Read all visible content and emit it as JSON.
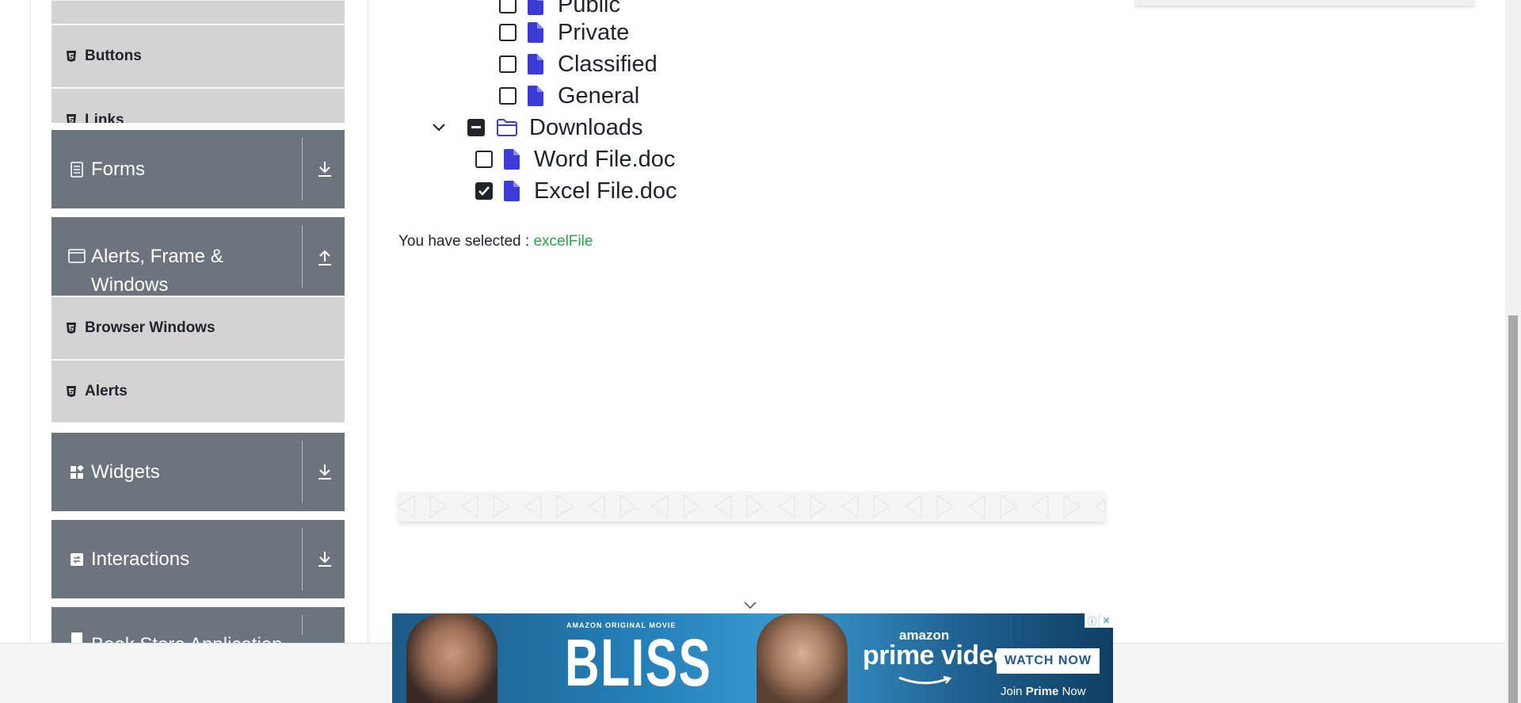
{
  "sidebar": {
    "elements_sub": [
      {
        "label": "Buttons"
      },
      {
        "label": "Links"
      }
    ],
    "groups": {
      "forms": "Forms",
      "alerts": "Alerts, Frame & Windows",
      "widgets": "Widgets",
      "interactions": "Interactions",
      "bookstore": "Book Store Application"
    },
    "alerts_sub": [
      {
        "label": "Browser Windows"
      },
      {
        "label": "Alerts"
      }
    ]
  },
  "tree": {
    "items": [
      {
        "label": "Public",
        "checked": false
      },
      {
        "label": "Private",
        "checked": false
      },
      {
        "label": "Classified",
        "checked": false
      },
      {
        "label": "General",
        "checked": false
      },
      {
        "label": "Downloads",
        "checked": "partial"
      },
      {
        "label": "Word File.doc",
        "checked": false
      },
      {
        "label": "Excel File.doc",
        "checked": true
      }
    ]
  },
  "result": {
    "prefix": "You have selected :",
    "value": "excelFile"
  },
  "banner": {
    "tag": "AMAZON ORIGINAL MOVIE",
    "title": "BLISS",
    "brand_small": "amazon",
    "brand_big": "prime video",
    "cta": "WATCH NOW",
    "join_prefix": "Join",
    "join_bold": "Prime",
    "join_suffix": "Now"
  },
  "colors": {
    "accent_green": "#28a745",
    "sidebar_group": "#6c757d",
    "sidebar_sub": "#d3d3d3",
    "file_icon": "#3b3bd6"
  }
}
